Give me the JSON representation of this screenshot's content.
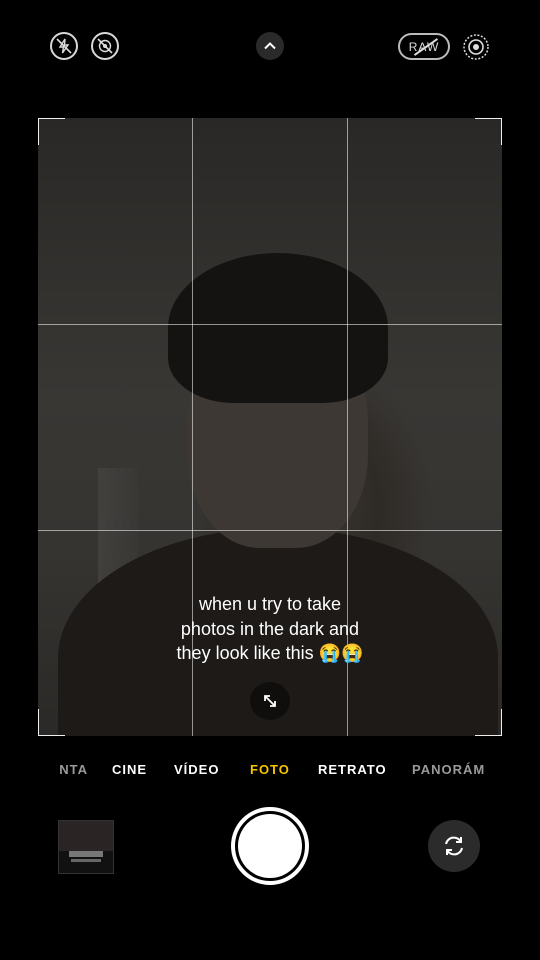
{
  "top_bar": {
    "flash_icon": "flash-off-icon",
    "live_icon": "live-photo-off-icon",
    "expand_icon": "chevron-up-icon",
    "raw_label": "RAW",
    "live_photo_icon": "live-photo-icon"
  },
  "caption": {
    "line1": "when u try to take",
    "line2": "photos in the dark and",
    "line3": "they look like this 😭😭"
  },
  "modes": [
    {
      "label": "LENTA"
    },
    {
      "label": "CINE"
    },
    {
      "label": "VÍDEO"
    },
    {
      "label": "FOTO"
    },
    {
      "label": "RETRATO"
    },
    {
      "label": "PANORÁMICA"
    }
  ],
  "active_mode": "FOTO",
  "colors": {
    "active_mode": "#f7c400",
    "background": "#000000"
  }
}
